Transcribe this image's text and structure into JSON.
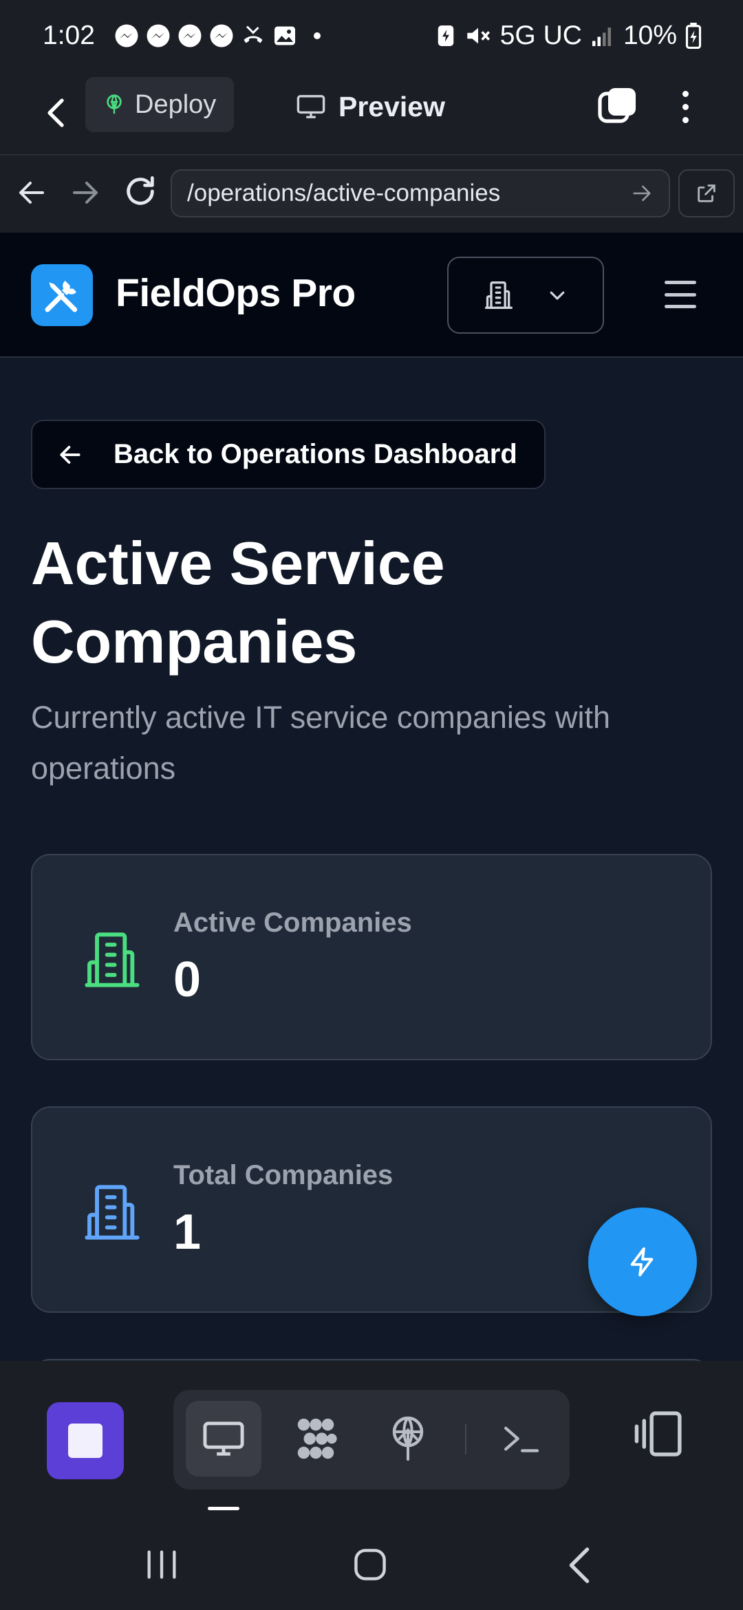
{
  "status_bar": {
    "time": "1:02",
    "network": "5G UC",
    "battery": "10%"
  },
  "browser": {
    "deploy_label": "Deploy",
    "preview_label": "Preview",
    "url": "/operations/active-companies"
  },
  "header": {
    "brand": "FieldOps Pro"
  },
  "main": {
    "back_label": "Back to Operations Dashboard",
    "title": "Active Service Companies",
    "subtitle": "Currently active IT service companies with operations",
    "stats": [
      {
        "label": "Active Companies",
        "value": "0",
        "icon": "building-icon",
        "color": "#4ade80"
      },
      {
        "label": "Total Companies",
        "value": "1",
        "icon": "building-icon",
        "color": "#60a5fa"
      }
    ]
  },
  "colors": {
    "accent": "#2196f3",
    "stop_button": "#5b3fd6",
    "background": "#111827",
    "card": "#1f2937"
  }
}
